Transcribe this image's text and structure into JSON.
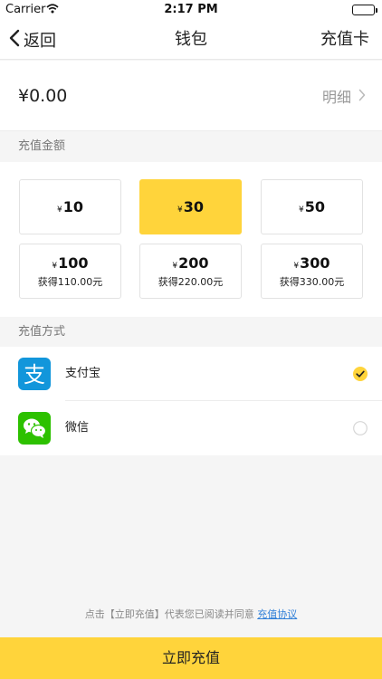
{
  "status_bar": {
    "carrier": "Carrier",
    "time": "2:17 PM"
  },
  "nav": {
    "back_label": "返回",
    "title": "钱包",
    "right_label": "充值卡"
  },
  "balance": {
    "amount": "¥0.00",
    "detail_label": "明细"
  },
  "amounts_section": {
    "label": "充值金额"
  },
  "amounts": [
    {
      "currency": "¥",
      "value": "10",
      "bonus": "",
      "selected": false
    },
    {
      "currency": "¥",
      "value": "30",
      "bonus": "",
      "selected": true
    },
    {
      "currency": "¥",
      "value": "50",
      "bonus": "",
      "selected": false
    },
    {
      "currency": "¥",
      "value": "100",
      "bonus": "获得110.00元",
      "selected": false
    },
    {
      "currency": "¥",
      "value": "200",
      "bonus": "获得220.00元",
      "selected": false
    },
    {
      "currency": "¥",
      "value": "300",
      "bonus": "获得330.00元",
      "selected": false
    }
  ],
  "payment_section": {
    "label": "充值方式"
  },
  "payment_methods": [
    {
      "label": "支付宝",
      "icon": "alipay-icon",
      "selected": true
    },
    {
      "label": "微信",
      "icon": "wechat-icon",
      "selected": false
    }
  ],
  "agreement": {
    "text": "点击【立即充值】代表您已阅读并同意",
    "link": "充值协议"
  },
  "submit": {
    "label": "立即充值"
  },
  "colors": {
    "accent": "#ffd43b",
    "alipay": "#1296db",
    "wechat": "#2dc100",
    "link": "#2f7fd8"
  }
}
